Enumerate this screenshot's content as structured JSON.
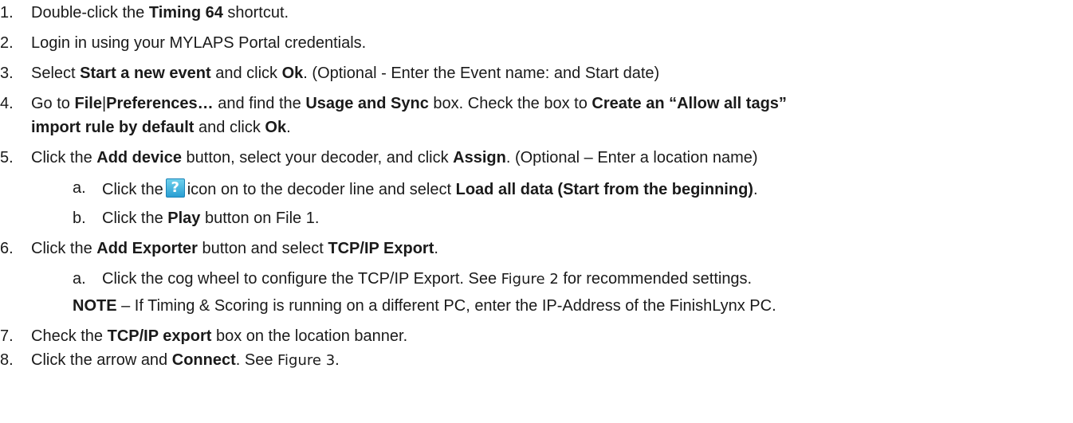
{
  "steps": [
    {
      "num": "1.",
      "parts": [
        {
          "t": "Double-click the "
        },
        {
          "t": "Timing 64",
          "b": true
        },
        {
          "t": " shortcut."
        }
      ]
    },
    {
      "num": "2.",
      "parts": [
        {
          "t": "Login in using your MYLAPS Portal credentials."
        }
      ]
    },
    {
      "num": "3.",
      "parts": [
        {
          "t": "Select "
        },
        {
          "t": "Start a new event",
          "b": true
        },
        {
          "t": " and click "
        },
        {
          "t": "Ok",
          "b": true
        },
        {
          "t": ". (Optional - Enter the Event name: and Start date)"
        }
      ]
    },
    {
      "num": "4.",
      "parts": [
        {
          "t": "Go to "
        },
        {
          "t": "File",
          "b": true
        },
        {
          "t": "|"
        },
        {
          "t": "Preferences…",
          "b": true
        },
        {
          "t": " and find the "
        },
        {
          "t": "Usage and Sync",
          "b": true
        },
        {
          "t": " box. Check the box to "
        },
        {
          "t": "Create an “Allow all tags”",
          "b": true
        }
      ]
    },
    {
      "num": "",
      "parts": [
        {
          "t": "import rule by default",
          "b": true
        },
        {
          "t": " and click "
        },
        {
          "t": "Ok",
          "b": true
        },
        {
          "t": "."
        }
      ]
    },
    {
      "num": "5.",
      "parts": [
        {
          "t": "Click the "
        },
        {
          "t": "Add device",
          "b": true
        },
        {
          "t": " button, select your decoder, and click "
        },
        {
          "t": "Assign",
          "b": true
        },
        {
          "t": ". (Optional – Enter a location name)"
        }
      ]
    },
    {
      "num": "a.",
      "sub": true,
      "parts": [
        {
          "t": "Click the"
        },
        {
          "icon": "help-icon",
          "glyph": "?"
        },
        {
          "t": "icon on to the decoder line and select "
        },
        {
          "t": "Load all data (Start from the beginning)",
          "b": true
        },
        {
          "t": "."
        }
      ]
    },
    {
      "num": "b.",
      "sub": true,
      "parts": [
        {
          "t": "Click the "
        },
        {
          "t": "Play",
          "b": true
        },
        {
          "t": " button on File 1."
        }
      ]
    },
    {
      "num": "6.",
      "parts": [
        {
          "t": "Click the "
        },
        {
          "t": "Add Exporter",
          "b": true
        },
        {
          "t": " button and select "
        },
        {
          "t": "TCP/IP Export",
          "b": true
        },
        {
          "t": "."
        }
      ]
    },
    {
      "num": "a.",
      "sub": true,
      "parts": [
        {
          "t": "Click the cog wheel to configure the TCP/IP Export. See "
        },
        {
          "t": "Figure 2",
          "cal": true
        },
        {
          "t": " for recommended settings."
        }
      ]
    },
    {
      "num": "",
      "note": true,
      "parts": [
        {
          "t": "NOTE",
          "b": true
        },
        {
          "t": " – If Timing & Scoring is running on a different PC, enter the IP-Address of the FinishLynx PC."
        }
      ]
    },
    {
      "num": "7.",
      "parts": [
        {
          "t": "Check the "
        },
        {
          "t": "TCP/IP export",
          "b": true
        },
        {
          "t": " box on the location banner."
        }
      ]
    },
    {
      "num": "8.",
      "parts": [
        {
          "t": "Click the arrow and "
        },
        {
          "t": "Connect",
          "b": true
        },
        {
          "t": ". See "
        },
        {
          "t": "Figure 3",
          "cal": true
        },
        {
          "t": "."
        }
      ]
    }
  ]
}
